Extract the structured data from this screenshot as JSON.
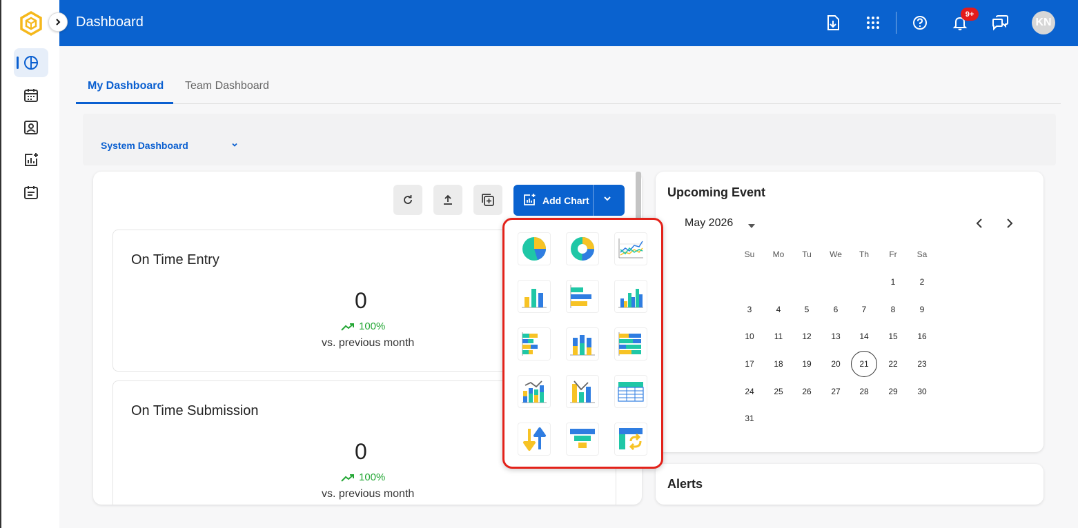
{
  "header": {
    "title": "Dashboard",
    "notification_count": "9+",
    "avatar_initials": "KN"
  },
  "tabs": [
    {
      "label": "My Dashboard",
      "active": true
    },
    {
      "label": "Team Dashboard",
      "active": false
    }
  ],
  "dashboard_selector": {
    "value": "System Dashboard"
  },
  "toolbar": {
    "add_chart_label": "Add Chart"
  },
  "stats": [
    {
      "title": "On Time Entry",
      "value": "0",
      "trend": "100%",
      "comparison": "vs. previous month"
    },
    {
      "title": "On Time Submission",
      "value": "0",
      "trend": "100%",
      "comparison": "vs. previous month"
    }
  ],
  "chart_types": [
    "pie-chart-icon",
    "donut-chart-icon",
    "line-chart-icon",
    "column-chart-icon",
    "bar-chart-icon",
    "grouped-column-chart-icon",
    "stacked-bar-chart-icon",
    "stacked-column-chart-icon",
    "stacked-100-bar-chart-icon",
    "combo-stacked-column-line-icon",
    "combo-column-line-icon",
    "table-chart-icon",
    "up-down-indicator-icon",
    "funnel-chart-icon",
    "pivot-chart-icon"
  ],
  "upcoming_event": {
    "title": "Upcoming Event",
    "month": "May 2026",
    "weekdays": [
      "Su",
      "Mo",
      "Tu",
      "We",
      "Th",
      "Fr",
      "Sa"
    ],
    "today": "21",
    "days": [
      "1",
      "2",
      "3",
      "4",
      "5",
      "6",
      "7",
      "8",
      "9",
      "10",
      "11",
      "12",
      "13",
      "14",
      "15",
      "16",
      "17",
      "18",
      "19",
      "20",
      "21",
      "22",
      "23",
      "24",
      "25",
      "26",
      "27",
      "28",
      "29",
      "30",
      "31"
    ]
  },
  "alerts": {
    "title": "Alerts"
  },
  "colors": {
    "primary": "#0a62cf",
    "teal": "#1fc7a6",
    "yellow": "#f7c325",
    "blue": "#2f7de1",
    "trend_green": "#22a633",
    "highlight_red": "#e3221a"
  }
}
